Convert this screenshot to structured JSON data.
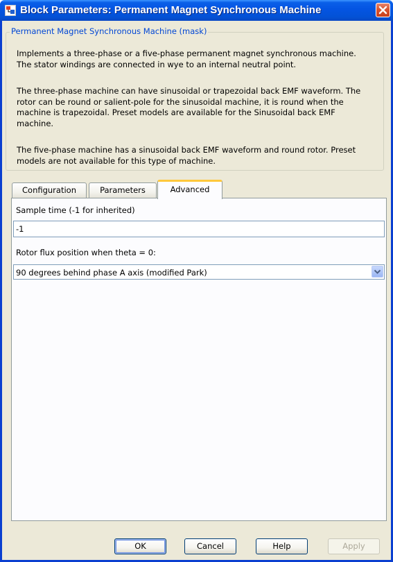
{
  "window": {
    "title": "Block Parameters: Permanent Magnet Synchronous Machine"
  },
  "mask": {
    "legend": "Permanent Magnet Synchronous Machine (mask)",
    "paragraphs": [
      "Implements a three-phase or a five-phase permanent magnet synchronous machine.\nThe stator windings are connected in wye to an internal neutral point.",
      "The three-phase machine can have sinusoidal or trapezoidal back EMF waveform. The\nrotor can be round or salient-pole for the sinusoidal machine, it is round when the\nmachine is trapezoidal. Preset models are available for the Sinusoidal back EMF\nmachine.",
      "The five-phase machine has a sinusoidal back EMF waveform and round rotor. Preset\nmodels are not available for this type of machine."
    ]
  },
  "tabs": [
    {
      "label": "Configuration",
      "active": false
    },
    {
      "label": "Parameters",
      "active": false
    },
    {
      "label": "Advanced",
      "active": true
    }
  ],
  "advanced": {
    "sample_time_label": "Sample time (-1 for inherited)",
    "sample_time_value": "-1",
    "rotor_flux_label": "Rotor flux position when theta = 0:",
    "rotor_flux_value": "90 degrees behind phase A axis (modified Park)"
  },
  "buttons": {
    "ok": "OK",
    "cancel": "Cancel",
    "help": "Help",
    "apply": "Apply"
  },
  "colors": {
    "titlebar": "#0454e2",
    "dialog_bg": "#ece9d8",
    "legend_text": "#0046d5",
    "active_tab_highlight": "#ffc83c"
  },
  "icons": {
    "title": "simulink-block-icon",
    "close": "close-icon",
    "dropdown": "chevron-down-icon"
  }
}
